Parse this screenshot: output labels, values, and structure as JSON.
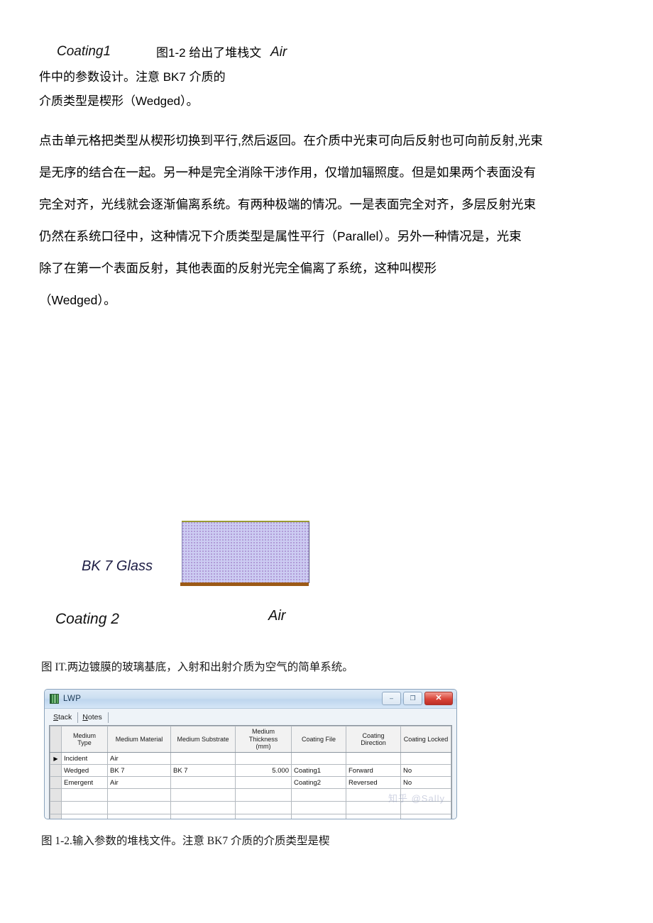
{
  "document": {
    "head_paragraph_lines": [
      "图1-2 给出了堆栈文",
      "件中的参数设计。注意 BK7 介质的",
      "介质类型是楔形（Wedged）。"
    ],
    "body_paragraph_lines": [
      "点击单元格把类型从楔形切换到平行,然后返回。在介质中光束可向后反射也可向前反射,光束",
      "是无序的结合在一起。另一种是完全消除干涉作用，仅增加辐照度。但是如果两个表面没有",
      "完全对齐，光线就会逐渐偏离系统。有两种极端的情况。一是表面完全对齐，多层反射光束",
      "仍然在系统口径中，这种情况下介质类型是属性平行（Parallel）。另外一种情况是，光束",
      "除了在第一个表面反射，其他表面的反射光完全偏离了系统，这种叫楔形",
      "（Wedged）。"
    ]
  },
  "diagram": {
    "coating1_label": "Coating1",
    "air_top_label": "Air",
    "bk7_label": "BK 7 Glass",
    "coating2_label": "Coating 2",
    "air_bottom_label": "Air",
    "colors": {
      "glass_fill": "#ccccf2",
      "top_coating": "#9a9a33",
      "bottom_coating": "#9c5a16"
    }
  },
  "captions": {
    "figure_1": "图 IT.两边镀膜的玻璃基底，入射和出射介质为空气的简单系统。",
    "figure_2": "图 1-2.输入参数的堆栈文件。注意 BK7 介质的介质类型是楔"
  },
  "lwp_window": {
    "title": "LWP",
    "app_icon": "lwp-app-icon",
    "window_buttons": {
      "minimize": "–",
      "maximize": "❐",
      "close": "✕"
    },
    "tabs": [
      {
        "label": "Stack",
        "accel": "S",
        "rest": "tack",
        "selected": true
      },
      {
        "label": "Notes",
        "accel": "N",
        "rest": "otes",
        "selected": false
      }
    ],
    "grid": {
      "columns": [
        "Medium Type",
        "Medium Material",
        "Medium Substrate",
        "Medium Thickness (mm)",
        "Coating File",
        "Coating Direction",
        "Coating Locked"
      ],
      "column_lines": [
        [
          "Medium",
          "Type"
        ],
        [
          "Medium Material"
        ],
        [
          "Medium Substrate"
        ],
        [
          "Medium",
          "Thickness",
          "(mm)"
        ],
        [
          "Coating File"
        ],
        [
          "Coating",
          "Direction"
        ],
        [
          "Coating Locked"
        ]
      ],
      "rows": [
        {
          "selected": true,
          "marker": "▶",
          "medium_type": "Incident",
          "medium_material": "Air",
          "medium_substrate": "",
          "medium_thickness": "",
          "coating_file": "",
          "coating_direction": "",
          "coating_locked": "",
          "coating_locked_blacked": true
        },
        {
          "selected": false,
          "marker": "",
          "medium_type": "Wedged",
          "medium_material": "BK 7",
          "medium_substrate": "BK 7",
          "medium_thickness": "5.000",
          "coating_file": "Coating1",
          "coating_direction": "Forward",
          "coating_locked": "No",
          "coating_locked_blacked": false
        },
        {
          "selected": false,
          "marker": "",
          "medium_type": "Emergent",
          "medium_material": "Air",
          "medium_substrate": "",
          "medium_thickness": "",
          "coating_file": "Coating2",
          "coating_direction": "Reversed",
          "coating_locked": "No",
          "coating_locked_blacked": false
        }
      ],
      "empty_row_count": 3
    },
    "watermark": "知乎 @Sally"
  }
}
